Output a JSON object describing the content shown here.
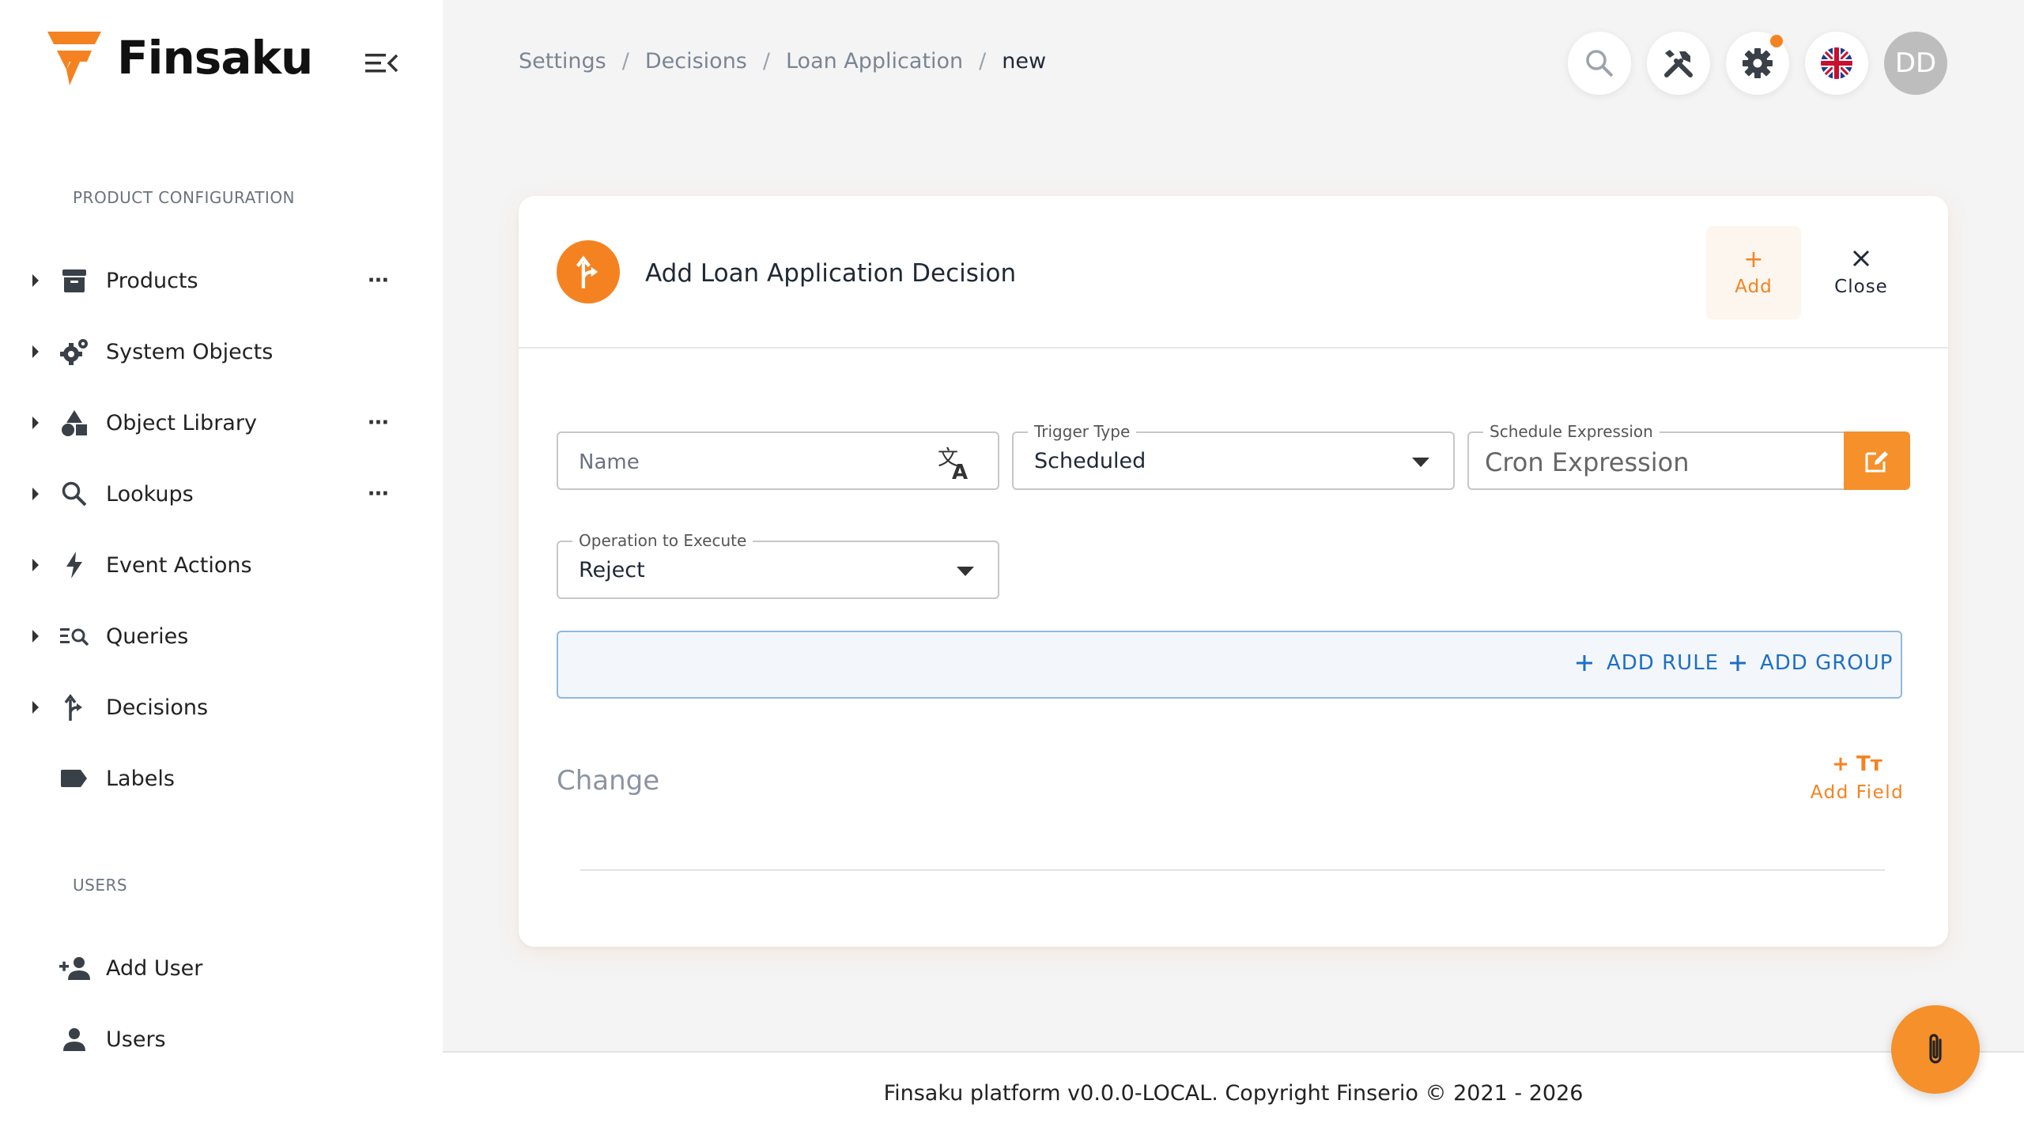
{
  "brand": {
    "name": "Finsaku",
    "accent_color": "#f58220"
  },
  "sidebar": {
    "sections": [
      {
        "title": "PRODUCT CONFIGURATION"
      },
      {
        "title": "USERS"
      }
    ],
    "items": [
      {
        "label": "Products",
        "icon": "archive-icon"
      },
      {
        "label": "System Objects",
        "icon": "gears-icon"
      },
      {
        "label": "Object Library",
        "icon": "shapes-icon"
      },
      {
        "label": "Lookups",
        "icon": "search-icon"
      },
      {
        "label": "Event Actions",
        "icon": "bolt-icon"
      },
      {
        "label": "Queries",
        "icon": "query-icon"
      },
      {
        "label": "Decisions",
        "icon": "split-arrow-icon"
      },
      {
        "label": "Labels",
        "icon": "label-icon"
      },
      {
        "label": "Add User",
        "icon": "add-user-icon"
      },
      {
        "label": "Users",
        "icon": "user-icon"
      }
    ],
    "more_glyph": "···"
  },
  "breadcrumb": {
    "items": [
      "Settings",
      "Decisions",
      "Loan Application",
      "new"
    ],
    "separator": "/"
  },
  "header": {
    "avatar_initials": "DD",
    "icons": [
      "search-icon",
      "tools-icon",
      "gear-icon",
      "uk-flag-icon"
    ]
  },
  "card": {
    "title": "Add Loan Application Decision",
    "add_label": "Add",
    "close_label": "Close"
  },
  "form": {
    "name": {
      "placeholder": "Name"
    },
    "trigger_type": {
      "label": "Trigger Type",
      "value": "Scheduled"
    },
    "schedule_expression": {
      "label": "Schedule Expression",
      "placeholder": "Cron Expression"
    },
    "operation": {
      "label": "Operation to Execute",
      "value": "Reject"
    }
  },
  "rules": {
    "add_rule_label": "ADD RULE",
    "add_group_label": "ADD GROUP",
    "color": "#1f6fc4"
  },
  "change": {
    "title": "Change",
    "add_field_label": "Add Field",
    "add_field_glyph": "+ Tт"
  },
  "footer": {
    "text": "Finsaku platform v0.0.0-LOCAL. Copyright Finserio © 2021 - 2026"
  }
}
